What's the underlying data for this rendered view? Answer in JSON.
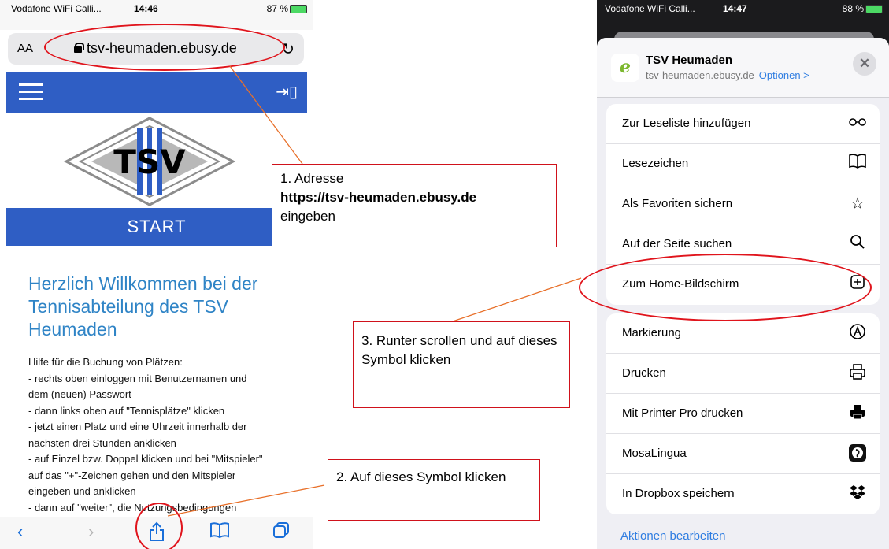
{
  "left": {
    "status": {
      "carrier": "Vodafone WiFi Calli...",
      "time": "14:46",
      "battery": "87 %"
    },
    "address_bar": {
      "aa": "AA",
      "url": "tsv-heumaden.ebusy.de",
      "reload_icon": "reload-icon"
    },
    "logo_text": "TSV",
    "start_label": "START",
    "heading": "Herzlich Willkommen bei der Tennisabteilung des  TSV Heumaden",
    "help_lines": [
      "Hilfe für die Buchung von Plätzen:",
      "- rechts oben einloggen mit Benutzernamen und",
      "dem (neuen) Passwort",
      "- dann links oben auf \"Tennisplätze\" klicken",
      "- jetzt einen Platz und eine Uhrzeit innerhalb der",
      "nächsten drei Stunden anklicken",
      "- auf Einzel bzw. Doppel klicken und bei \"Mitspieler\"",
      "auf das \"+\"-Zeichen gehen und den Mitspieler",
      "eingeben und anklicken",
      "- dann auf \"weiter\", die Nutzungsbedingungen"
    ]
  },
  "right": {
    "status": {
      "carrier": "Vodafone WiFi Calli...",
      "time": "14:47",
      "battery": "88 %"
    },
    "sheet": {
      "title": "TSV Heumaden",
      "domain": "tsv-heumaden.ebusy.de",
      "options": "Optionen >",
      "close": "✕",
      "app_letter": "e"
    },
    "group1": [
      {
        "label": "Zur Leseliste hinzufügen",
        "icon": "glasses-icon"
      },
      {
        "label": "Lesezeichen",
        "icon": "book-icon"
      },
      {
        "label": "Als Favoriten sichern",
        "icon": "star-icon"
      },
      {
        "label": "Auf der Seite suchen",
        "icon": "search-icon"
      },
      {
        "label": "Zum Home-Bildschirm",
        "icon": "add-square-icon"
      }
    ],
    "group2": [
      {
        "label": "Markierung",
        "icon": "markup-icon"
      },
      {
        "label": "Drucken",
        "icon": "print-icon"
      },
      {
        "label": "Mit Printer Pro drucken",
        "icon": "printer-pro-icon"
      },
      {
        "label": "MosaLingua",
        "icon": "mosalingua-icon"
      },
      {
        "label": "In Dropbox speichern",
        "icon": "dropbox-icon"
      }
    ],
    "aktionen": "Aktionen bearbeiten"
  },
  "annotations": {
    "box1": {
      "line1": "1. Adresse",
      "url": "https://tsv-heumaden.ebusy.de",
      "line3": "eingeben"
    },
    "box2": {
      "text": "2. Auf dieses Symbol klicken"
    },
    "box3": {
      "text": "3. Runter scrollen und auf dieses Symbol klicken"
    }
  },
  "colors": {
    "site_blue": "#2f5ec4",
    "heading_blue": "#2f84c6",
    "ios_blue": "#1a6fd9",
    "annotation_red": "#d0121b",
    "arrow_orange": "#e8702a"
  }
}
